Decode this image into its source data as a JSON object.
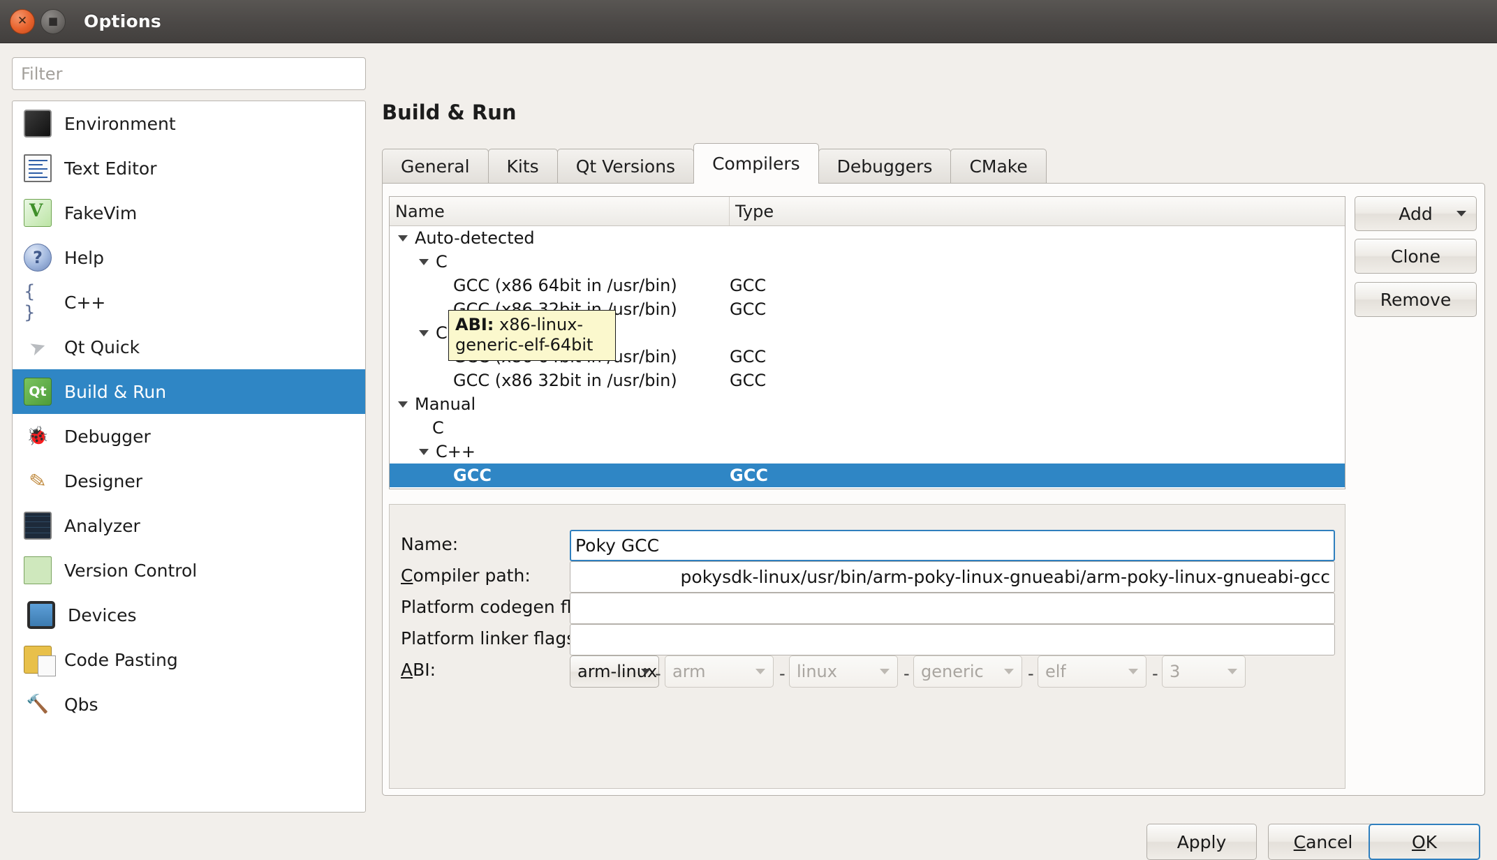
{
  "window": {
    "title": "Options",
    "close_icon": "close-icon",
    "maximize_icon": "maximize-icon"
  },
  "search": {
    "placeholder": "Filter",
    "value": ""
  },
  "sidebar": {
    "items": [
      {
        "label": "Environment",
        "icon": "environment-icon",
        "selected": false
      },
      {
        "label": "Text Editor",
        "icon": "text-editor-icon",
        "selected": false
      },
      {
        "label": "FakeVim",
        "icon": "fakevim-icon",
        "selected": false
      },
      {
        "label": "Help",
        "icon": "help-icon",
        "selected": false
      },
      {
        "label": "C++",
        "icon": "cpp-icon",
        "selected": false
      },
      {
        "label": "Qt Quick",
        "icon": "qt-quick-icon",
        "selected": false
      },
      {
        "label": "Build & Run",
        "icon": "build-and-run-icon",
        "selected": true
      },
      {
        "label": "Debugger",
        "icon": "debugger-icon",
        "selected": false
      },
      {
        "label": "Designer",
        "icon": "designer-icon",
        "selected": false
      },
      {
        "label": "Analyzer",
        "icon": "analyzer-icon",
        "selected": false
      },
      {
        "label": "Version Control",
        "icon": "version-control-icon",
        "selected": false
      },
      {
        "label": "Devices",
        "icon": "devices-icon",
        "selected": false
      },
      {
        "label": "Code Pasting",
        "icon": "code-pasting-icon",
        "selected": false
      },
      {
        "label": "Qbs",
        "icon": "qbs-icon",
        "selected": false
      }
    ]
  },
  "main": {
    "page_title": "Build & Run",
    "tabs": [
      {
        "label": "General",
        "active": false
      },
      {
        "label": "Kits",
        "active": false
      },
      {
        "label": "Qt Versions",
        "active": false
      },
      {
        "label": "Compilers",
        "active": true
      },
      {
        "label": "Debuggers",
        "active": false
      },
      {
        "label": "CMake",
        "active": false
      }
    ],
    "tree": {
      "columns": [
        "Name",
        "Type"
      ],
      "rows": [
        {
          "name": "Auto-detected",
          "type": "",
          "indent": 0,
          "expander": "down",
          "selected": false
        },
        {
          "name": "C",
          "type": "",
          "indent": 1,
          "expander": "down",
          "selected": false
        },
        {
          "name": "GCC (x86 64bit in /usr/bin)",
          "type": "GCC",
          "indent": 2,
          "expander": "none",
          "selected": false
        },
        {
          "name": "GCC (x86 32bit in /usr/bin)",
          "type": "GCC",
          "indent": 2,
          "expander": "none",
          "selected": false
        },
        {
          "name": "C++",
          "type": "",
          "indent": 1,
          "expander": "down",
          "selected": false
        },
        {
          "name": "GCC (x86 64bit in /usr/bin)",
          "type": "GCC",
          "indent": 2,
          "expander": "none",
          "selected": false
        },
        {
          "name": "GCC (x86 32bit in /usr/bin)",
          "type": "GCC",
          "indent": 2,
          "expander": "none",
          "selected": false
        },
        {
          "name": "Manual",
          "type": "",
          "indent": 0,
          "expander": "down",
          "selected": false
        },
        {
          "name": "C",
          "type": "",
          "indent": 1,
          "expander": "none",
          "selected": false
        },
        {
          "name": "C++",
          "type": "",
          "indent": 1,
          "expander": "down",
          "selected": false
        },
        {
          "name": "GCC",
          "type": "GCC",
          "indent": 2,
          "expander": "none",
          "selected": true
        }
      ]
    },
    "tooltip": {
      "label": "ABI:",
      "value": "x86-linux-generic-elf-64bit"
    },
    "side_buttons": {
      "add": "Add",
      "clone": "Clone",
      "remove": "Remove",
      "add_caret_icon": "chevron-down-icon"
    },
    "detail_form": {
      "name": {
        "label": "Name:",
        "value": "Poky GCC",
        "focused": true
      },
      "compiler_path": {
        "label": "Compiler path:",
        "label_mnemonic": "C",
        "value": "pokysdk-linux/usr/bin/arm-poky-linux-gnueabi/arm-poky-linux-gnueabi-gcc"
      },
      "platform_codegen_flags": {
        "label": "Platform codegen flags:",
        "value": ""
      },
      "platform_linker_flags": {
        "label": "Platform linker flags:",
        "value": ""
      },
      "abi": {
        "label": "ABI:",
        "label_mnemonic": "A",
        "combos": [
          {
            "value": "arm-linux",
            "disabled": false
          },
          {
            "value": "arm",
            "disabled": true
          },
          {
            "value": "linux",
            "disabled": true
          },
          {
            "value": "generic",
            "disabled": true
          },
          {
            "value": "elf",
            "disabled": true
          },
          {
            "value": "3",
            "disabled": true
          }
        ],
        "separator": "-"
      }
    }
  },
  "footer": {
    "apply": "Apply",
    "cancel": "Cancel",
    "ok": "OK"
  }
}
